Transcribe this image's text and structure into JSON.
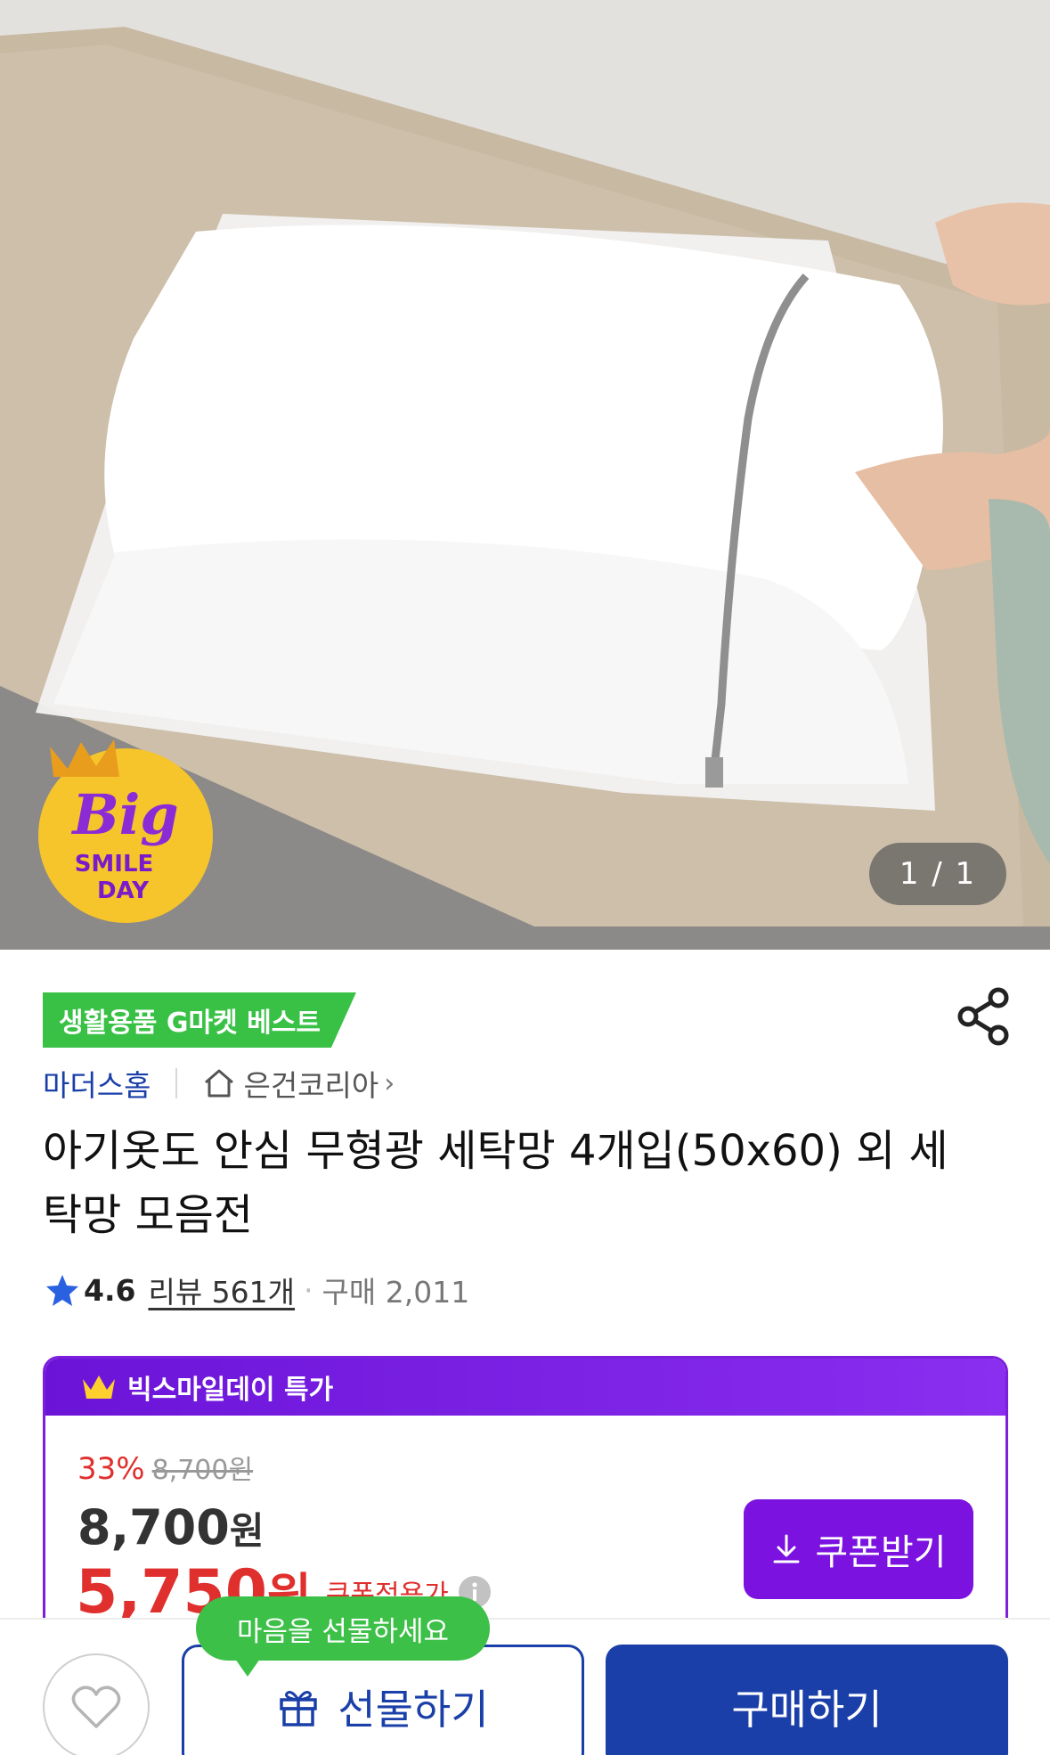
{
  "hero": {
    "image_label": "세탁망 상품 이미지",
    "promo_badge_line1": "Big",
    "promo_badge_line2": "SMILE",
    "promo_badge_line3": "DAY",
    "image_counter": "1 / 1"
  },
  "product": {
    "category_badge": "생활용품 G마켓 베스트",
    "brand": "마더스홈",
    "shop_name": "은건코리아",
    "shop_chevron": "›",
    "title": "아기옷도 안심 무형광 세탁망 4개입(50x60) 외 세탁망 모음전",
    "rating": "4.6",
    "review_label": "리뷰 561개",
    "separator": "·",
    "purchase_count": "구매 2,011"
  },
  "deal": {
    "header": "빅스마일데이 특가",
    "discount_rate": "33%",
    "original_price": "8,700원",
    "sale_price_number": "8,700",
    "sale_price_unit": "원",
    "coupon_price_number": "5,750",
    "coupon_price_unit": "원",
    "coupon_price_label": "쿠폰적용가",
    "coupon_button": "쿠폰받기"
  },
  "bottom_bar": {
    "gift_tooltip": "마음을 선물하세요",
    "gift_button": "선물하기",
    "buy_button": "구매하기"
  },
  "colors": {
    "brand_blue": "#1a3fa8",
    "deal_purple": "#7b12e0",
    "price_red": "#e0302e",
    "badge_green": "#39c146"
  },
  "icons": {
    "share": "share-icon",
    "home": "home-icon",
    "star": "star-icon",
    "crown": "crown-icon",
    "info": "info-icon",
    "download": "download-icon",
    "heart": "heart-icon",
    "gift": "gift-icon"
  }
}
